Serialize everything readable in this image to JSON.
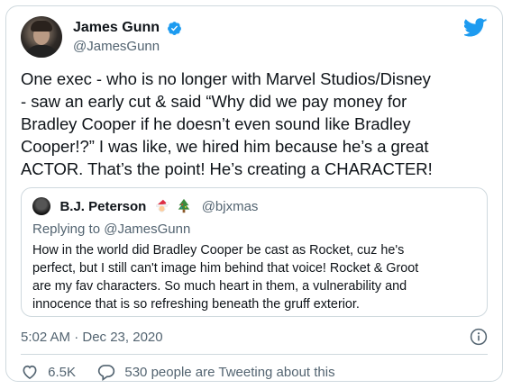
{
  "author": {
    "display_name": "James Gunn",
    "handle": "@JamesGunn",
    "verified": true
  },
  "icons": {
    "verified": "verified-badge-icon",
    "brand": "twitter-bird-icon",
    "info": "info-icon",
    "like": "heart-icon",
    "reply": "speech-bubble-icon"
  },
  "colors": {
    "accent": "#1d9bf0",
    "text": "#0f1419",
    "secondary": "#536471",
    "border": "#cfd9de"
  },
  "tweet": {
    "lines": [
      "One exec - who is no longer with Marvel Studios/Disney",
      "- saw an early cut & said “Why did we pay money for",
      "Bradley Cooper if he doesn’t even sound like Bradley",
      "Cooper!?” I was like, we hired him because he’s a great",
      "ACTOR. That’s the point! He’s creating a CHARACTER!"
    ]
  },
  "quoted": {
    "display_name": "B.J. Peterson",
    "emoji": [
      "santa-emoji",
      "christmas-tree-emoji"
    ],
    "handle": "@bjxmas",
    "replying_to": "Replying to @JamesGunn",
    "lines": [
      "How in the world did Bradley Cooper be cast as Rocket, cuz he's",
      "perfect, but I still can't image him behind that voice! Rocket & Groot",
      "are my fav characters. So much heart in them, a vulnerability and",
      "innocence that is so refreshing beneath the gruff exterior."
    ]
  },
  "timestamp": "5:02 AM · Dec 23, 2020",
  "actions": {
    "likes": "6.5K",
    "conversation": "530 people are Tweeting about this"
  }
}
